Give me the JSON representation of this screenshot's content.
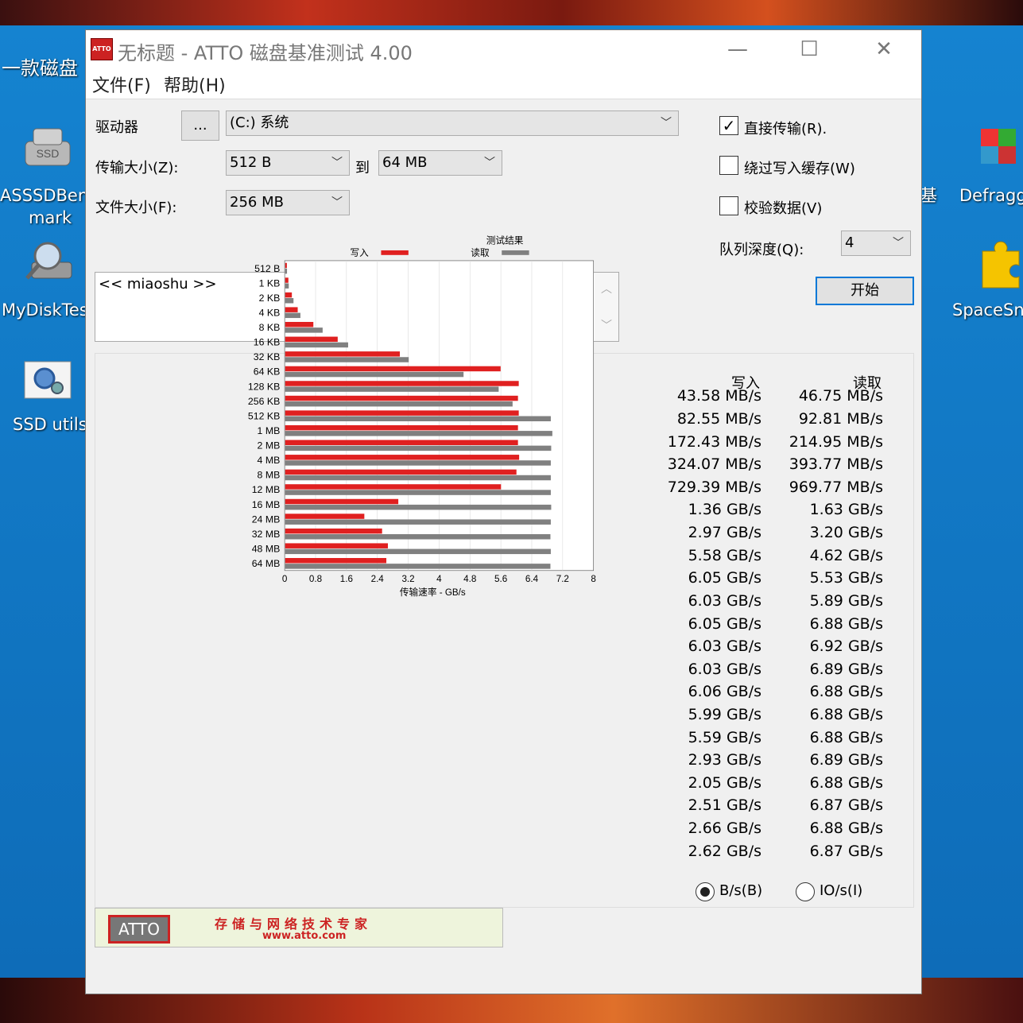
{
  "desktop": {
    "top_label": "一款磁盘",
    "icons": [
      {
        "label_line1": "ASSSDBenc",
        "label_line2": "mark"
      },
      {
        "label_line1": "MyDiskTes",
        "label_line2": ""
      },
      {
        "label_line1": "SSD utils",
        "label_line2": ""
      },
      {
        "label_line1": "Defragg",
        "label_line2": ""
      },
      {
        "label_line1": "SpaceSni",
        "label_line2": ""
      }
    ],
    "partial_right_label": "基"
  },
  "window": {
    "title": "无标题 - ATTO 磁盘基准测试 4.00",
    "icon_text": "ATTO",
    "minimize": "—",
    "maximize": "☐",
    "close": "✕"
  },
  "menu": {
    "file": "文件(F)",
    "help": "帮助(H)"
  },
  "form": {
    "drive_label": "驱动器",
    "browse_button": "...",
    "drive_value": "(C:) 系统",
    "transfer_label": "传输大小(Z):",
    "transfer_from": "512 B",
    "to_label": "到",
    "transfer_to": "64 MB",
    "filesize_label": "文件大小(F):",
    "filesize_value": "256 MB",
    "direct_io_label": "直接传输(R).",
    "direct_io_checked": true,
    "bypass_cache_label": "绕过写入缓存(W)",
    "bypass_cache_checked": false,
    "verify_label": "校验数据(V)",
    "verify_checked": false,
    "queue_label": "队列深度(Q):",
    "queue_value": "4",
    "start_button": "开始",
    "description": "<< miaoshu >>"
  },
  "results": {
    "title": "测试结果",
    "legend_write": "写入",
    "legend_read": "读取",
    "col_write": "写入",
    "col_read": "读取",
    "xlabel": "传输速率 - GB/s",
    "unit_bytes": "B/s(B)",
    "unit_io": "IO/s(I)",
    "unit_selected": "bytes",
    "rows": [
      {
        "write": "43.58 MB/s",
        "read": "46.75 MB/s"
      },
      {
        "write": "82.55 MB/s",
        "read": "92.81 MB/s"
      },
      {
        "write": "172.43 MB/s",
        "read": "214.95 MB/s"
      },
      {
        "write": "324.07 MB/s",
        "read": "393.77 MB/s"
      },
      {
        "write": "729.39 MB/s",
        "read": "969.77 MB/s"
      },
      {
        "write": "1.36 GB/s",
        "read": "1.63 GB/s"
      },
      {
        "write": "2.97 GB/s",
        "read": "3.20 GB/s"
      },
      {
        "write": "5.58 GB/s",
        "read": "4.62 GB/s"
      },
      {
        "write": "6.05 GB/s",
        "read": "5.53 GB/s"
      },
      {
        "write": "6.03 GB/s",
        "read": "5.89 GB/s"
      },
      {
        "write": "6.05 GB/s",
        "read": "6.88 GB/s"
      },
      {
        "write": "6.03 GB/s",
        "read": "6.92 GB/s"
      },
      {
        "write": "6.03 GB/s",
        "read": "6.89 GB/s"
      },
      {
        "write": "6.06 GB/s",
        "read": "6.88 GB/s"
      },
      {
        "write": "5.99 GB/s",
        "read": "6.88 GB/s"
      },
      {
        "write": "5.59 GB/s",
        "read": "6.88 GB/s"
      },
      {
        "write": "2.93 GB/s",
        "read": "6.89 GB/s"
      },
      {
        "write": "2.05 GB/s",
        "read": "6.88 GB/s"
      },
      {
        "write": "2.51 GB/s",
        "read": "6.87 GB/s"
      },
      {
        "write": "2.66 GB/s",
        "read": "6.88 GB/s"
      },
      {
        "write": "2.62 GB/s",
        "read": "6.87 GB/s"
      }
    ]
  },
  "chart_data": {
    "type": "bar",
    "orientation": "horizontal",
    "categories": [
      "512 B",
      "1 KB",
      "2 KB",
      "4 KB",
      "8 KB",
      "16 KB",
      "32 KB",
      "64 KB",
      "128 KB",
      "256 KB",
      "512 KB",
      "1 MB",
      "2 MB",
      "4 MB",
      "8 MB",
      "12 MB",
      "16 MB",
      "24 MB",
      "32 MB",
      "48 MB",
      "64 MB"
    ],
    "series": [
      {
        "name": "写入",
        "color": "#e02020",
        "values": [
          0.04358,
          0.08255,
          0.17243,
          0.32407,
          0.72939,
          1.36,
          2.97,
          5.58,
          6.05,
          6.03,
          6.05,
          6.03,
          6.03,
          6.06,
          5.99,
          5.59,
          2.93,
          2.05,
          2.51,
          2.66,
          2.62
        ]
      },
      {
        "name": "读取",
        "color": "#808080",
        "values": [
          0.04675,
          0.09281,
          0.21495,
          0.39377,
          0.96977,
          1.63,
          3.2,
          4.62,
          5.53,
          5.89,
          6.88,
          6.92,
          6.89,
          6.88,
          6.88,
          6.88,
          6.89,
          6.88,
          6.87,
          6.88,
          6.87
        ]
      }
    ],
    "xticks": [
      "0",
      "0.8",
      "1.6",
      "2.4",
      "3.2",
      "4",
      "4.8",
      "5.6",
      "6.4",
      "7.2",
      "8"
    ],
    "xlim": [
      0,
      8
    ],
    "xlabel": "传输速率 - GB/s",
    "title": "测试结果",
    "grid": "vertical"
  },
  "banner": {
    "logo": "ATTO",
    "slogan": "存储与网络技术专家",
    "url": "www.atto.com"
  }
}
